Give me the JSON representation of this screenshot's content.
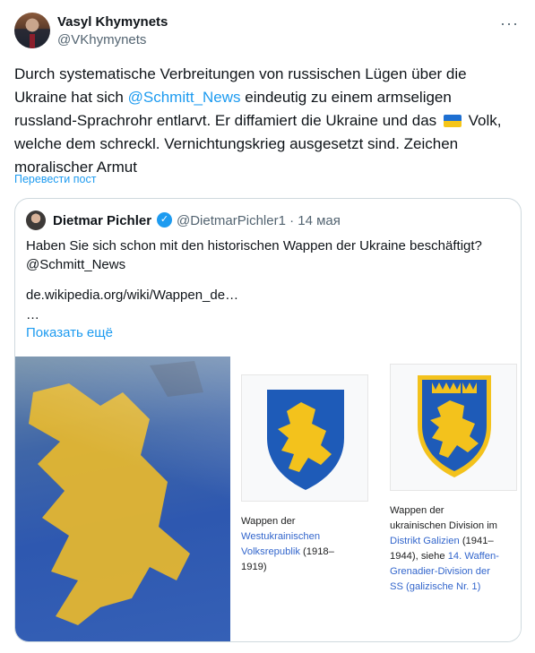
{
  "tweet": {
    "author_name": "Vasyl Khymynets",
    "author_handle": "@VKhymynets",
    "more_icon": "more-horizontal-icon",
    "text_lines": {
      "l1": "Durch systematische Verbreitungen von russischen Lügen über die",
      "l2a": "Ukraine  hat sich ",
      "l2_mention": "@Schmitt_News",
      "l2b": " eindeutig zu einem armseligen",
      "l3a": "russland-Sprachrohr entlarvt. Er diffamiert die Ukraine und das ",
      "l3_flag": "ukraine-flag-icon",
      "l3b": " Volk,",
      "l4": "welche dem schreckl. Vernichtungskrieg ausgesetzt sind. Zeichen",
      "l5": "moralischer Armut"
    },
    "translate_label": "Перевести пост"
  },
  "quote": {
    "author_name": "Dietmar Pichler",
    "verified_icon": "verified-badge-icon",
    "handle_date": "@DietmarPichler1 · 14 мая",
    "text_l1": "Haben Sie sich schon mit den historischen Wappen der Ukraine beschäftigt?",
    "text_l2": "@Schmitt_News",
    "link": "de.wikipedia.org/wiki/Wappen_de…",
    "ellipsis": "…",
    "show_more": "Показать ещё",
    "card1": {
      "c1": "Wappen der",
      "c2": "Westukrainischen",
      "c3a": "Volksrepublik",
      "c3b": " (1918–",
      "c4": "1919)"
    },
    "card2": {
      "c1": "Wappen der",
      "c2": "ukrainischen Division im",
      "c3a": "Distrikt Galizien",
      "c3b": " (1941–",
      "c4a": "1944), siehe ",
      "c4b": "14. Waffen-",
      "c5": "Grenadier-Division der",
      "c6": "SS (galizische Nr. 1)"
    }
  },
  "colors": {
    "accent": "#1d9bf0",
    "wiki_link": "#3366cc",
    "shield_blue": "#1e5bb8",
    "lion_gold": "#f3c21c"
  }
}
